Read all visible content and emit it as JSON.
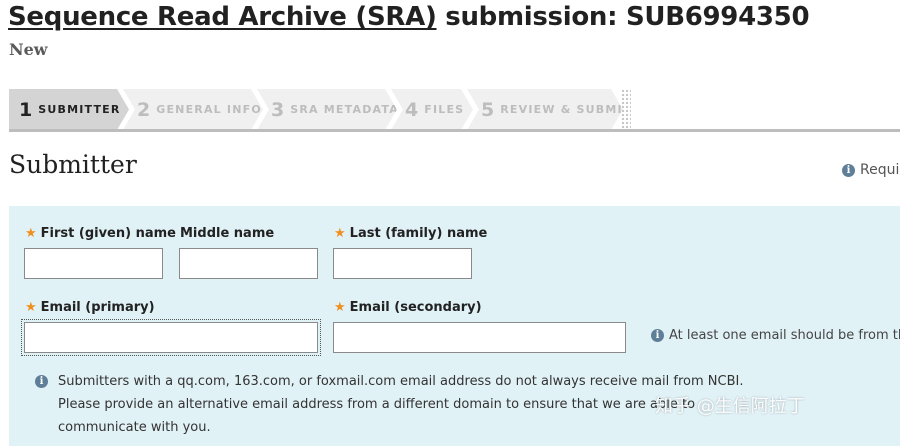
{
  "header": {
    "title_link": "Sequence Read Archive (SRA)",
    "title_rest": " submission: SUB6994350",
    "status": "New"
  },
  "steps": [
    {
      "num": "1",
      "label": "SUBMITTER",
      "active": true
    },
    {
      "num": "2",
      "label": "GENERAL INFO",
      "active": false
    },
    {
      "num": "3",
      "label": "SRA METADATA",
      "active": false
    },
    {
      "num": "4",
      "label": "FILES",
      "active": false
    },
    {
      "num": "5",
      "label": "REVIEW & SUBMIT",
      "active": false
    }
  ],
  "section": {
    "title": "Submitter",
    "required_note": "Requir"
  },
  "form": {
    "first_name": {
      "label": "First (given) name",
      "required": true,
      "value": ""
    },
    "middle_name": {
      "label": "Middle name",
      "required": false,
      "value": ""
    },
    "last_name": {
      "label": "Last (family) name",
      "required": true,
      "value": ""
    },
    "email_primary": {
      "label": "Email (primary)",
      "required": true,
      "value": ""
    },
    "email_secondary": {
      "label": "Email (secondary)",
      "required": true,
      "value": ""
    },
    "email_hint": "At least one email should be from th"
  },
  "notice": {
    "line1": "Submitters with a qq.com, 163.com, or foxmail.com email address do not always receive mail from NCBI.",
    "line2": "Please provide an alternative email address from a different domain to ensure that we are able to",
    "line3": "communicate with you."
  },
  "watermark": "知乎 @生信阿拉丁",
  "colors": {
    "panel_bg": "#e1f2f7",
    "required_star": "#ef8f1e",
    "info_icon": "#5f7f98",
    "active_step": "#d4d4d4",
    "inactive_step": "#f0f0f0"
  }
}
